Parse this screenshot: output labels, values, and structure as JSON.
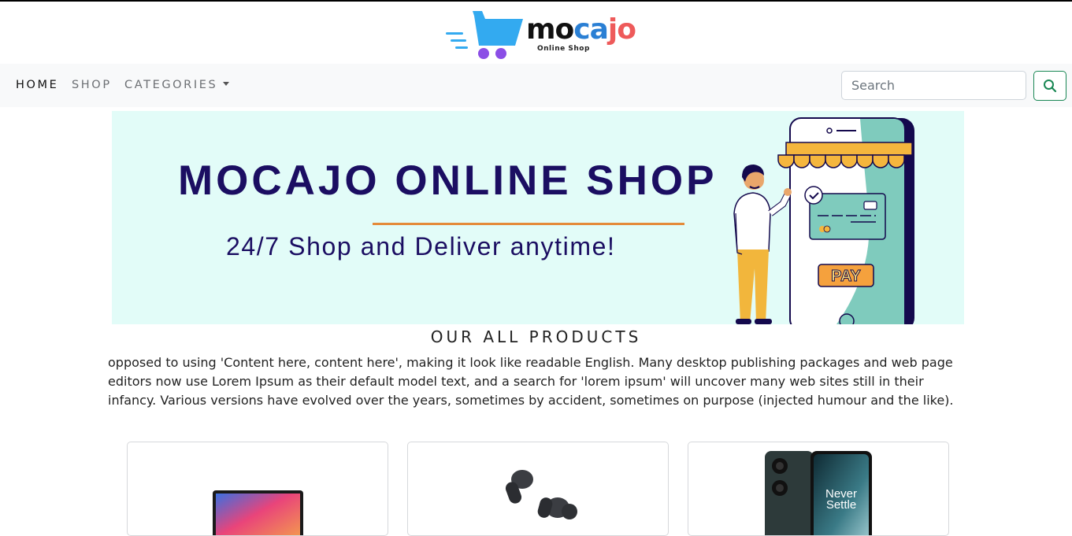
{
  "brand": {
    "logo_part1": "mo",
    "logo_part2": "ca",
    "logo_part3": "jo",
    "tagline": "Online Shop",
    "colors": {
      "cart": "#33aaf0",
      "wheels": "#8b4ee6",
      "dark": "#111111",
      "blue": "#2a7fd4",
      "red": "#ee5a5a"
    }
  },
  "navbar": {
    "items": [
      {
        "label": "HOME",
        "active": true
      },
      {
        "label": "SHOP",
        "active": false
      },
      {
        "label": "CATEGORIES",
        "active": false,
        "dropdown": true
      }
    ],
    "search": {
      "placeholder": "Search",
      "value": ""
    },
    "search_button_icon": "search-icon",
    "accent_color": "#198754"
  },
  "banner": {
    "title": "MOCAJO ONLINE SHOP",
    "subtitle": "24/7 Shop and Deliver anytime!",
    "pay_label": "PAY",
    "colors": {
      "background": "#e2fcf8",
      "text": "#1b0e62",
      "line": "#e48b3a"
    }
  },
  "products_section": {
    "title": "OUR ALL PRODUCTS",
    "description": "opposed to using 'Content here, content here', making it look like readable English. Many desktop publishing packages and web page editors now use Lorem Ipsum as their default model text, and a search for 'lorem ipsum' will uncover many web sites still in their infancy. Various versions have evolved over the years, sometimes by accident, sometimes on purpose (injected humour and the like)."
  },
  "products": [
    {
      "image": "laptop-image"
    },
    {
      "image": "earbuds-image"
    },
    {
      "image": "phone-image",
      "image_text_line1": "Never",
      "image_text_line2": "Settle"
    }
  ]
}
